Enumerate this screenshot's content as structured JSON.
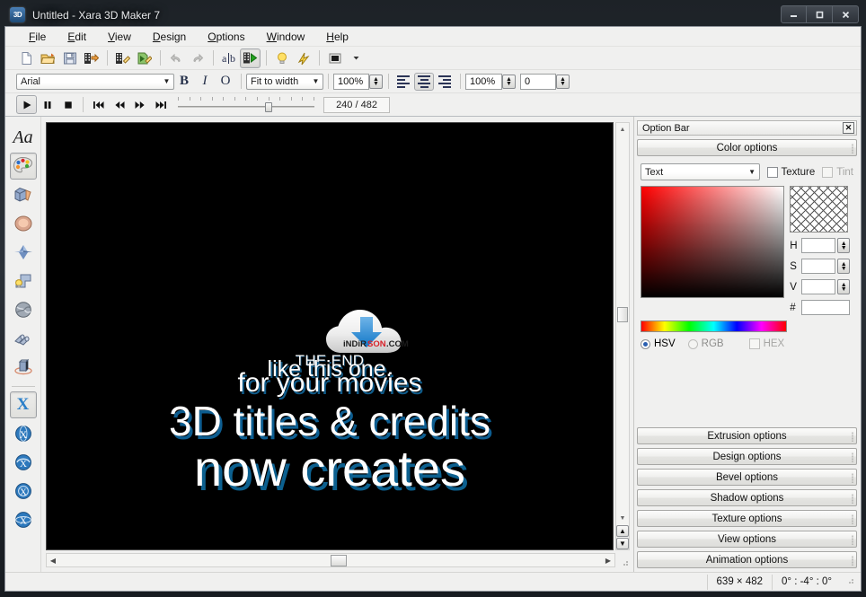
{
  "window": {
    "title": "Untitled - Xara 3D Maker 7",
    "app_icon": "app-3d-icon",
    "buttons": {
      "minimize": "—",
      "maximize": "❑",
      "close": "✕"
    }
  },
  "menu": {
    "items": [
      {
        "label": "File",
        "accel": "F"
      },
      {
        "label": "Edit",
        "accel": "E"
      },
      {
        "label": "View",
        "accel": "V"
      },
      {
        "label": "Design",
        "accel": "D"
      },
      {
        "label": "Options",
        "accel": "O"
      },
      {
        "label": "Window",
        "accel": "W"
      },
      {
        "label": "Help",
        "accel": "H"
      }
    ]
  },
  "toolbar_main": {
    "buttons": [
      {
        "name": "new-document-button",
        "icon": "new-page-icon"
      },
      {
        "name": "open-document-button",
        "icon": "open-folder-icon"
      },
      {
        "name": "save-document-button",
        "icon": "floppy-save-icon"
      },
      {
        "name": "export-animation-button",
        "icon": "film-export-icon"
      },
      {
        "name": "import-button",
        "icon": "film-import-icon"
      },
      {
        "name": "export-flash-button",
        "icon": "flash-export-icon"
      },
      {
        "name": "undo-button",
        "icon": "undo-arrow-icon"
      },
      {
        "name": "redo-button",
        "icon": "redo-arrow-icon"
      },
      {
        "name": "text-tool-button",
        "icon": "ab-text-icon"
      },
      {
        "name": "animation-preview-button",
        "icon": "film-play-icon"
      },
      {
        "name": "lights-button",
        "icon": "lightbulb-icon"
      },
      {
        "name": "fast-render-button",
        "icon": "lightning-icon"
      },
      {
        "name": "background-button",
        "icon": "background-square-icon"
      }
    ]
  },
  "toolbar_text": {
    "font": {
      "value": "Arial",
      "placeholder": "Arial"
    },
    "bold_label": "B",
    "italic_label": "I",
    "outline_label": "O",
    "fit_mode": {
      "value": "Fit to width"
    },
    "zoom": {
      "value": "100%"
    },
    "align": {
      "left": "align-left",
      "center": "align-center",
      "right": "align-right",
      "selected": "center"
    },
    "scale": {
      "value": "100%"
    },
    "rotation": {
      "value": "0"
    }
  },
  "toolbar_animation": {
    "play_label": "▶",
    "pause_label": "❙❙",
    "stop_label": "■",
    "first_label": "◀◀|",
    "prev_label": "◀◀",
    "next_label": "▶▶",
    "last_label": "|▶▶",
    "frame_counter": "240 / 482",
    "slider_position_percent": 64
  },
  "tool_palette": {
    "items": [
      {
        "name": "text-tool",
        "icon": "Aa",
        "label": "Text",
        "selected": false
      },
      {
        "name": "color-tool",
        "icon": "palette-icon",
        "label": "Color",
        "selected": true
      },
      {
        "name": "extrude-tool",
        "icon": "extrude-cube-icon",
        "label": "Extrusion",
        "selected": false
      },
      {
        "name": "bevel-tool",
        "icon": "bevel-sphere-icon",
        "label": "Bevel",
        "selected": false
      },
      {
        "name": "shadow-tool",
        "icon": "shadow-diamond-icon",
        "label": "Shadow",
        "selected": false
      },
      {
        "name": "lighting-tool",
        "icon": "light-bulb-icon",
        "label": "Lighting",
        "selected": false
      },
      {
        "name": "texture-tool",
        "icon": "texture-ball-icon",
        "label": "Texture",
        "selected": false
      },
      {
        "name": "material-tool",
        "icon": "material-roll-icon",
        "label": "Materials",
        "selected": false
      },
      {
        "name": "rotate-tool",
        "icon": "rotate-cube-icon",
        "label": "Rotate",
        "selected": false
      },
      {
        "name": "x-static-tool",
        "icon": "letter-x-icon",
        "label": "No animation",
        "selected": true
      },
      {
        "name": "x-rotate-tool",
        "icon": "x-sphere-icon",
        "label": "Rotate animation",
        "selected": false
      },
      {
        "name": "x-swing-tool",
        "icon": "x-swing-icon",
        "label": "Swing animation",
        "selected": false
      },
      {
        "name": "x-pulse-tool",
        "icon": "x-pulse-icon",
        "label": "Pulse animation",
        "selected": false
      },
      {
        "name": "x-spin-tool",
        "icon": "x-spin-icon",
        "label": "Spin animation",
        "selected": false
      }
    ]
  },
  "canvas": {
    "background_color": "#000000",
    "watermark": {
      "text_left": "iNDiR",
      "text_mid": "SON",
      "text_right": ".COM",
      "icon": "cloud-download-icon"
    },
    "text_lines": [
      {
        "id": "theend",
        "text": "THE END"
      },
      {
        "id": "likethis",
        "text": "like this one."
      },
      {
        "id": "movies",
        "text": "for your movies"
      },
      {
        "id": "titles",
        "text": "3D titles & credits"
      },
      {
        "id": "now",
        "text": "now creates"
      }
    ],
    "text_color": "#ffffff",
    "extrude_color": "#0d5d90"
  },
  "option_bar": {
    "title": "Option Bar",
    "close_label": "✕",
    "color_options_label": "Color options",
    "color": {
      "target_select": {
        "value": "Text"
      },
      "texture_checkbox": {
        "label": "Texture",
        "checked": false,
        "enabled": true
      },
      "tint_checkbox": {
        "label": "Tint",
        "checked": false,
        "enabled": false
      },
      "fields": [
        {
          "label": "H",
          "value": ""
        },
        {
          "label": "S",
          "value": ""
        },
        {
          "label": "V",
          "value": ""
        }
      ],
      "hex_field": {
        "label": "#",
        "value": ""
      },
      "mode": {
        "hsv_label": "HSV",
        "rgb_label": "RGB",
        "selected": "HSV"
      },
      "hex_checkbox": {
        "label": "HEX",
        "checked": false,
        "enabled": false
      }
    },
    "panels": [
      {
        "label": "Extrusion options"
      },
      {
        "label": "Design options"
      },
      {
        "label": "Bevel options"
      },
      {
        "label": "Shadow options"
      },
      {
        "label": "Texture options"
      },
      {
        "label": "View options"
      },
      {
        "label": "Animation options"
      }
    ]
  },
  "status_bar": {
    "dimensions": "639 × 482",
    "angles": "0° : -4° : 0°"
  }
}
